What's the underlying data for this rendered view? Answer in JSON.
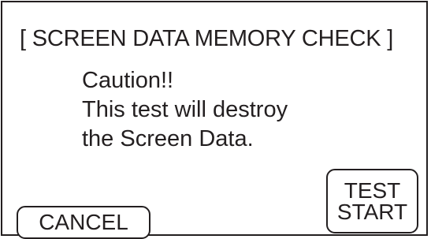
{
  "dialog": {
    "title": "[ SCREEN DATA MEMORY CHECK ]",
    "message_lines": [
      "Caution!!",
      "This test will destroy",
      "the Screen Data."
    ]
  },
  "buttons": {
    "cancel_label": "CANCEL",
    "test_start_label_line1": "TEST",
    "test_start_label_line2": "START"
  }
}
